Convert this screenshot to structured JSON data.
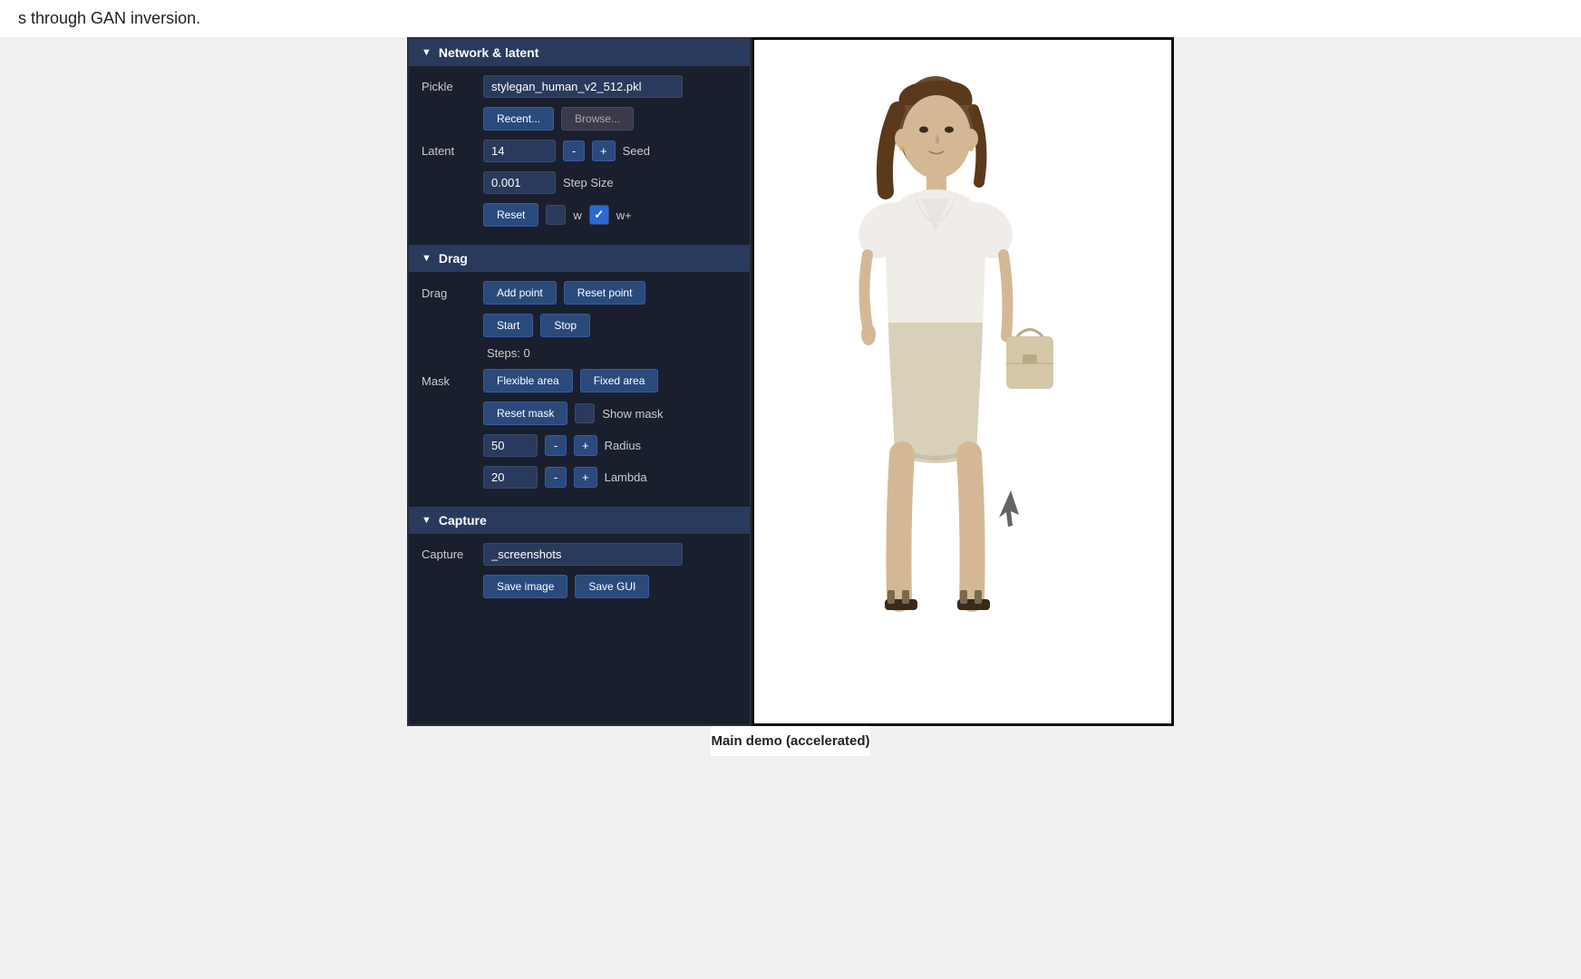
{
  "header": {
    "text": "s through GAN inversion."
  },
  "sections": {
    "network_latent": {
      "label": "Network & latent",
      "pickle_value": "stylegan_human_v2_512.pkl",
      "recent_btn": "Recent...",
      "browse_btn": "Browse...",
      "latent_value": "14",
      "seed_label": "Seed",
      "step_minus": "-",
      "step_plus": "+",
      "step_size_value": "0.001",
      "step_size_label": "Step Size",
      "reset_btn": "Reset",
      "w_label": "w",
      "w_plus_label": "w+"
    },
    "drag": {
      "label": "Drag",
      "drag_label": "Drag",
      "add_point_btn": "Add point",
      "reset_point_btn": "Reset point",
      "start_btn": "Start",
      "stop_btn": "Stop",
      "steps_text": "Steps: 0",
      "mask_label": "Mask",
      "flexible_area_btn": "Flexible area",
      "fixed_area_btn": "Fixed area",
      "reset_mask_btn": "Reset mask",
      "show_mask_btn": "Show mask",
      "radius_value": "50",
      "radius_minus": "-",
      "radius_plus": "+",
      "radius_label": "Radius",
      "lambda_value": "20",
      "lambda_minus": "-",
      "lambda_plus": "+",
      "lambda_label": "Lambda"
    },
    "capture": {
      "label": "Capture",
      "capture_label": "Capture",
      "capture_value": "_screenshots",
      "save_image_btn": "Save image",
      "save_gui_btn": "Save GUI"
    }
  },
  "caption": "Main demo (accelerated)",
  "icons": {
    "triangle_down": "▼",
    "checkmark": "✓"
  }
}
